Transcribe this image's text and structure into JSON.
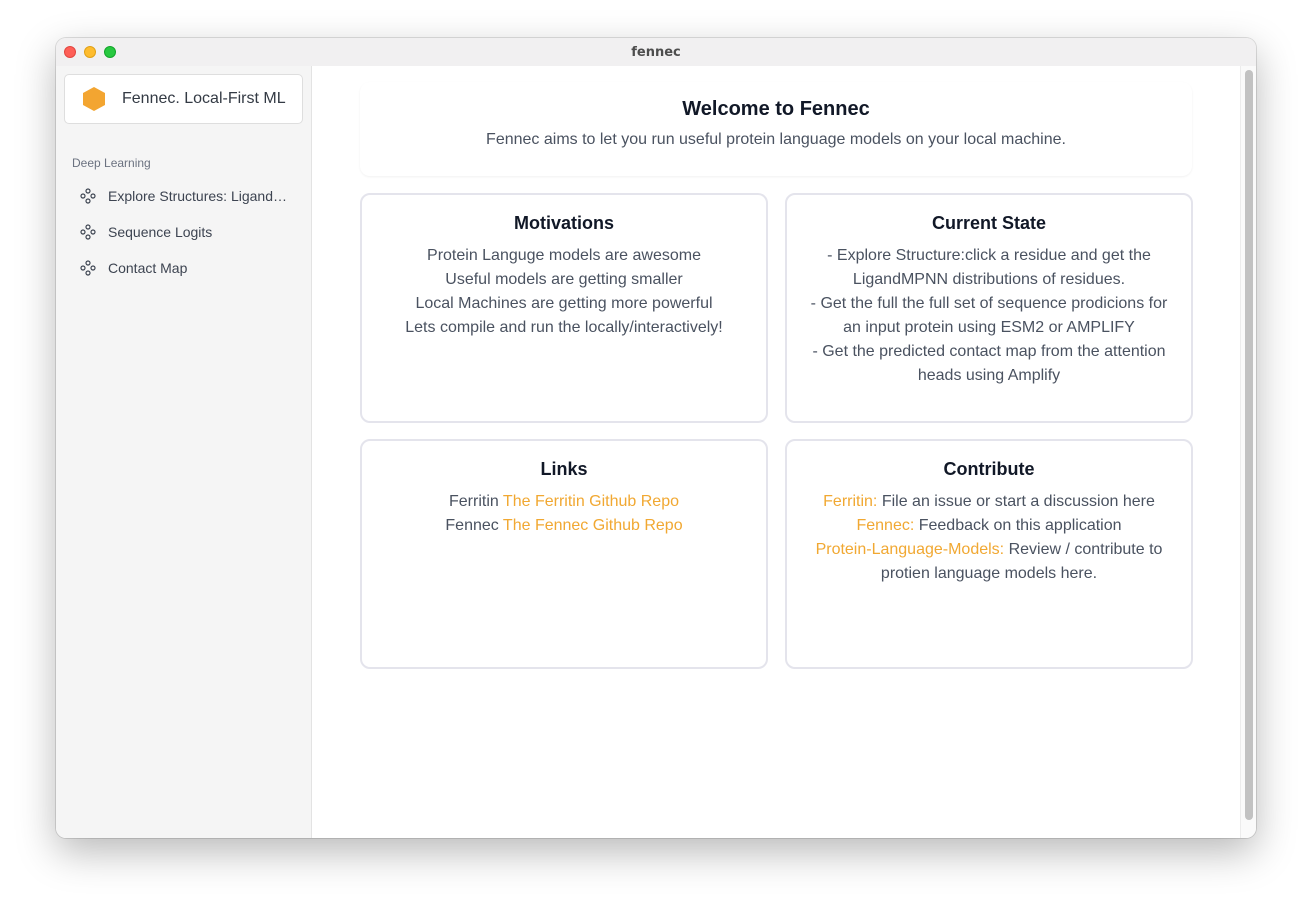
{
  "window": {
    "title": "fennec"
  },
  "sidebar": {
    "brand": "Fennec. Local-First ML",
    "section_label": "Deep Learning",
    "items": [
      {
        "label": "Explore Structures: Ligand…",
        "icon": "molecule-icon"
      },
      {
        "label": "Sequence Logits",
        "icon": "molecule-icon"
      },
      {
        "label": "Contact Map",
        "icon": "molecule-icon"
      }
    ]
  },
  "welcome": {
    "title": "Welcome to Fennec",
    "subtitle": "Fennec aims to let you run useful protein language models on your local machine."
  },
  "motivations": {
    "title": "Motivations",
    "lines": [
      "Protein Languge models are awesome",
      "Useful models are getting smaller",
      "Local Machines are getting more powerful",
      "Lets compile and run the locally/interactively!"
    ]
  },
  "current_state": {
    "title": "Current State",
    "lines": [
      "- Explore Structure:click a residue and get the LigandMPNN distributions of residues.",
      "- Get the full the full set of sequence prodicions for an input protein using ESM2 or AMPLIFY",
      "- Get the predicted contact map from the attention heads using Amplify"
    ]
  },
  "links": {
    "title": "Links",
    "items": [
      {
        "prefix": "Ferritin",
        "link": "The Ferritin Github Repo"
      },
      {
        "prefix": "Fennec",
        "link": "The Fennec Github Repo"
      }
    ]
  },
  "contribute": {
    "title": "Contribute",
    "items": [
      {
        "link": "Ferritin:",
        "text": "File an issue or start a discussion here"
      },
      {
        "link": "Fennec:",
        "text": "Feedback on this application"
      },
      {
        "link": "Protein-Language-Models:",
        "text": "Review / contribute to protien language models here."
      }
    ]
  },
  "colors": {
    "accent": "#f1a832",
    "logo": "#f3a531"
  }
}
